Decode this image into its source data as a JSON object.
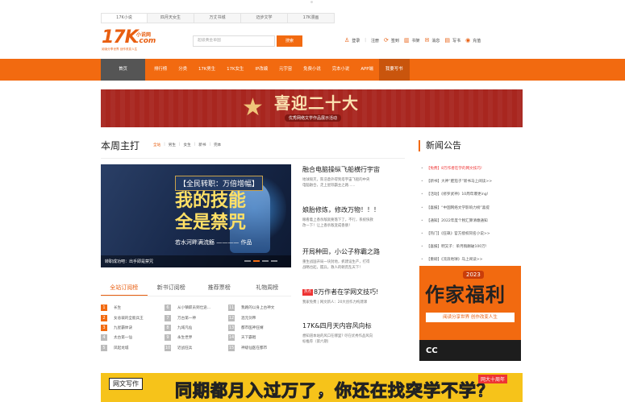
{
  "top_tabs": [
    "17K小说",
    "四月天女生",
    "万丈书城",
    "迈步文学",
    "17K漫画"
  ],
  "logo": {
    "brand": "17K",
    "cn": "小说网",
    "com": ".com",
    "slogan": "阅读分享世界 创作改变人生"
  },
  "search": {
    "placeholder": "超级黄金单国",
    "button": "搜索"
  },
  "user_bar": {
    "login": "登录",
    "register": "注册",
    "sign": "签到",
    "shelf": "书架",
    "message": "消息",
    "write_book": "写书",
    "recharge": "充值",
    "sep": "|"
  },
  "nav": [
    "首页",
    "排行榜",
    "分类",
    "17K男生",
    "17K女生",
    "IP改编",
    "元宇宙",
    "免费小说",
    "完本小说",
    "APP端",
    "我要写书"
  ],
  "banner": {
    "title": "喜迎二十大",
    "subtitle": "优秀网络文学作品展示活动"
  },
  "weekly": {
    "title": "本周主打",
    "filters": [
      "全站",
      "男生",
      "女生",
      "新书",
      "完本"
    ],
    "sep": "|"
  },
  "hero": {
    "tag": "【全民转职：万倍增幅】",
    "line1": "我的技能",
    "line2": "全是禁咒",
    "author": "若水河畔满流觞 ———— 作品",
    "caption": "转职成功吧：出手即是禁咒"
  },
  "news": [
    {
      "title": "融合电脑操纵飞船横行宇宙",
      "desc": [
        "地球毁灭，陈浩意外得到塔宇宙飞船的中央",
        "电脑融合，走上星际霸主之路......"
      ],
      "tag": ""
    },
    {
      "title": "娘胎修炼，修改万物！！！",
      "desc": [
        "眼看着上香杀敌就要落下了，不行，系统快救",
        "改一下！让上香杀敌变成香肠！"
      ],
      "tag": ""
    },
    {
      "title": "开局种田，小公子称霸之路",
      "desc": [
        "重生战国开局一块封地，抓建设生产，打得",
        "战略也起，握兵，救人的朝荒乱天下！"
      ],
      "tag": ""
    },
    {
      "title": "8万作者在学网文技巧!",
      "desc": [
        "我家免费 | 网文新人：20大创作力构建课"
      ],
      "tag": "热点"
    },
    {
      "title": "17K&四月天内容风向标",
      "desc": [
        "想知道本站的风口在哪里? 尽在优秀作品风向",
        "标推荐（第六期）"
      ],
      "tag": ""
    }
  ],
  "rank_tabs": [
    "全站订阅榜",
    "新书订阅榜",
    "推荐票榜",
    "礼物周榜"
  ],
  "rank_cols": [
    [
      "长生",
      "女总裁的全能兵王",
      "九星霸体诀",
      "太古第一仙",
      "凤起龙城"
    ],
    [
      "从小镇职员到仕途...",
      "万古第一神",
      "九域凡仙",
      "永生世界",
      "近战狂兵"
    ],
    [
      "我路的以身上古神文",
      "混元剑帝",
      "都市医神狂婿",
      "天下霸唱",
      "神级仙医在都市"
    ]
  ],
  "announcements": {
    "title": "新闻公告",
    "items": [
      "【免费】8万作者在学的网文技巧!",
      "【新书】大神“肥茄子”新书马上阅读>>",
      "【活动】《修罗武神》10周年爆更ing!",
      "【喜报】“中国网络文学影响力榜”喜提",
      "【通知】2022年度个税汇算清缴通知",
      "【热门】《狂飙》官方授权同名小说>>",
      "【喜报】明又子：单月稿酬破100万!",
      "【重磅】《流浪地球》马上阅读>>"
    ]
  },
  "ad": {
    "year": "2023",
    "title": "作家福利",
    "subtitle": "阅读分享世界 创作改变人生",
    "mark": "CC"
  },
  "bottom_banner": {
    "label": "网文写作",
    "text": "同期都月入过万了，你还在找突学不学？",
    "badge": "网大十周年"
  },
  "colors": {
    "brand_orange": "#f26a10",
    "nav_home": "#555555",
    "banner_red": "#a8261f"
  }
}
